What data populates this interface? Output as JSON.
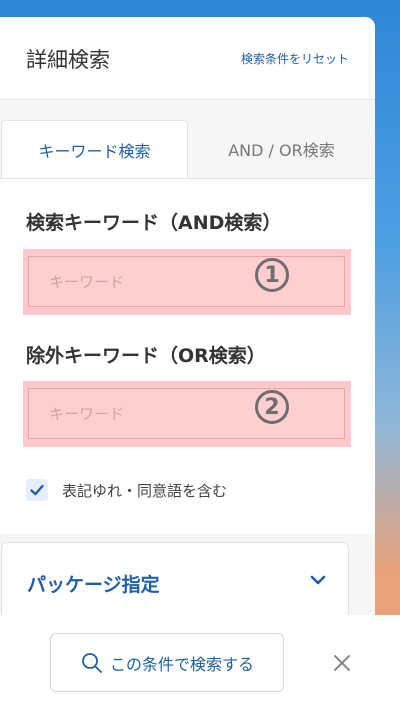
{
  "header": {
    "title": "詳細検索",
    "reset_label": "検索条件をリセット"
  },
  "tabs": [
    {
      "label": "キーワード検索",
      "active": true
    },
    {
      "label": "AND / OR検索",
      "active": false
    }
  ],
  "and_search": {
    "label": "検索キーワード（AND検索）",
    "placeholder": "キーワード",
    "value": "",
    "marker": "1"
  },
  "or_search": {
    "label": "除外キーワード（OR検索）",
    "placeholder": "キーワード",
    "value": "",
    "marker": "2"
  },
  "synonym_option": {
    "label": "表記ゆれ・同意語を含む",
    "checked": true
  },
  "package": {
    "label": "パッケージ指定"
  },
  "footer": {
    "search_label": "この条件で検索する"
  },
  "colors": {
    "accent": "#1f5fa6",
    "highlight": "#ffc9cb"
  }
}
